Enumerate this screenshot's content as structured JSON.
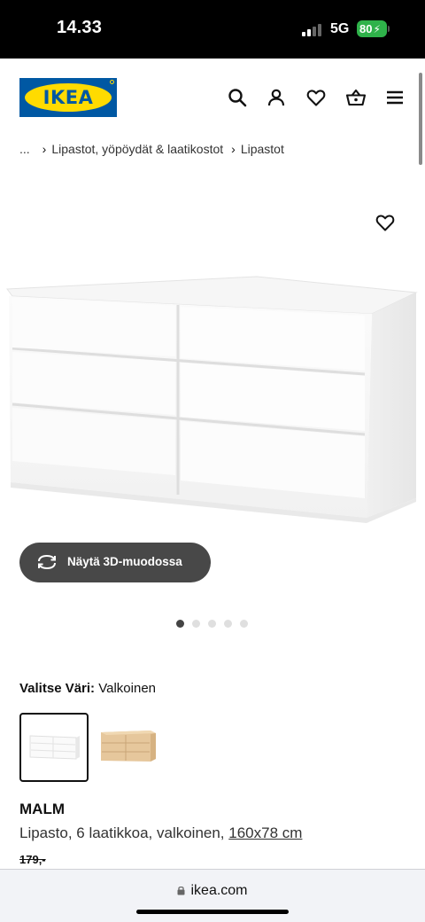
{
  "status_bar": {
    "time": "14.33",
    "network": "5G",
    "battery": "80"
  },
  "header": {
    "logo_text": "IKEA",
    "icons": [
      "search-icon",
      "account-icon",
      "heart-icon",
      "basket-icon",
      "menu-icon"
    ]
  },
  "breadcrumb": {
    "ellipsis": "...",
    "items": [
      "Lipastot, yöpöydät & laatikostot",
      "Lipastot"
    ]
  },
  "gallery": {
    "view_3d_label": "Näytä 3D-muodossa",
    "total_images": 5,
    "active_image": 1
  },
  "color_selection": {
    "label": "Valitse Väri:",
    "value": "Valkoinen",
    "options": [
      {
        "name": "white",
        "selected": true
      },
      {
        "name": "white-stained-oak",
        "selected": false
      }
    ]
  },
  "product": {
    "name": "MALM",
    "description": "Lipasto, 6 laatikkoa, valkoinen, ",
    "dimensions": "160x78 cm",
    "old_price": "179,-"
  },
  "browser": {
    "url": "ikea.com"
  },
  "colors": {
    "brand_blue": "#0058a3",
    "brand_yellow": "#ffdb00",
    "button_dark": "#484848",
    "battery_green": "#2fb24a"
  }
}
